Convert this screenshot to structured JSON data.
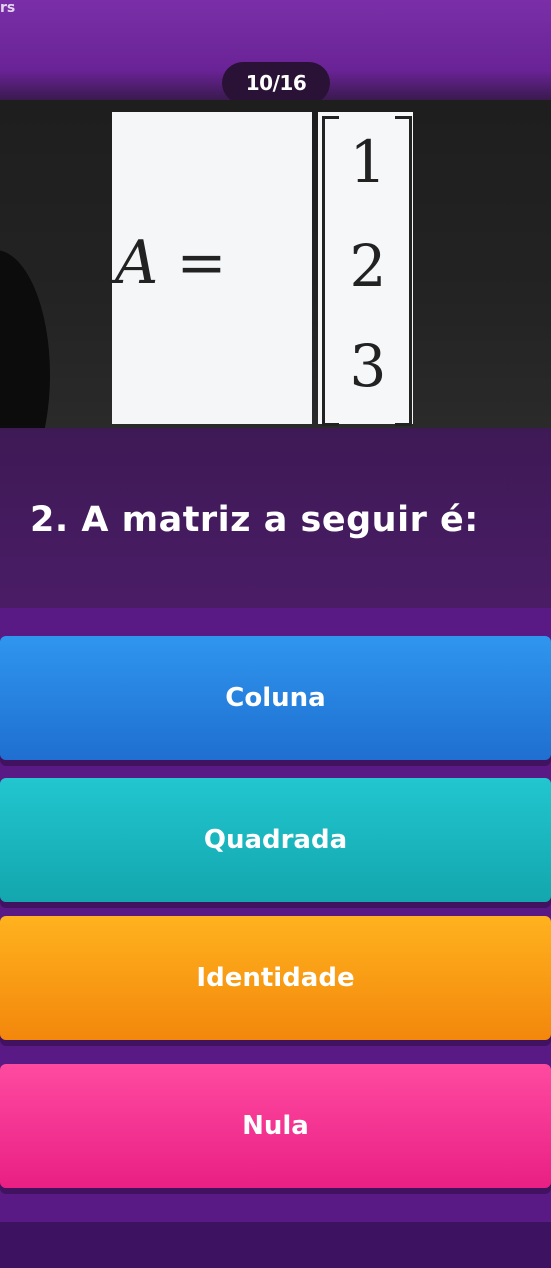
{
  "corner_label": "rs",
  "progress": {
    "text": "10/16",
    "current": 10,
    "total": 16
  },
  "equation": {
    "lhs": "A",
    "equals": "=",
    "column_vector": [
      "1",
      "2",
      "3"
    ]
  },
  "question": {
    "text": "2. A matriz a seguir é:"
  },
  "answers": [
    {
      "label": "Coluna",
      "color": "#2a86e6"
    },
    {
      "label": "Quadrada",
      "color": "#19b8c1"
    },
    {
      "label": "Identidade",
      "color": "#f9a019"
    },
    {
      "label": "Nula",
      "color": "#f43894"
    }
  ],
  "theme": {
    "background": "#5a1a86"
  }
}
